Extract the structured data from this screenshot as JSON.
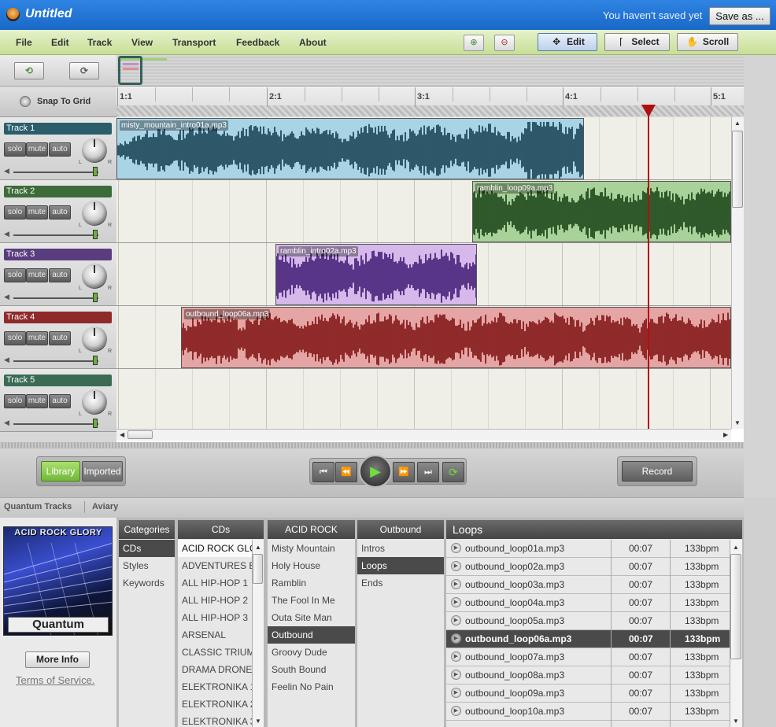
{
  "titlebar": {
    "title": "Untitled",
    "status": "You haven't saved yet",
    "save_as": "Save as ..."
  },
  "menu": {
    "items": [
      "File",
      "Edit",
      "Track",
      "View",
      "Transport",
      "Feedback",
      "About"
    ]
  },
  "modes": {
    "edit": "Edit",
    "select": "Select",
    "scroll": "Scroll"
  },
  "snap_to_grid": "Snap To Grid",
  "ruler": {
    "labels": [
      "1:1",
      "2:1",
      "3:1",
      "4:1",
      "5:1"
    ]
  },
  "tracks": [
    {
      "name": "Track 1",
      "color": "#2b5d6b",
      "clip": "misty_mountain_intro01a.mp3"
    },
    {
      "name": "Track 2",
      "color": "#3e6b3a",
      "clip": "ramblin_loop09a.mp3"
    },
    {
      "name": "Track 3",
      "color": "#5a3d7e",
      "clip": "ramblin_intro02a.mp3"
    },
    {
      "name": "Track 4",
      "color": "#8e2a2a",
      "clip": "outbound_loop06a.mp3"
    },
    {
      "name": "Track 5",
      "color": "#3b6b55",
      "clip": ""
    }
  ],
  "track_buttons": {
    "solo": "solo",
    "mute": "mute",
    "auto": "auto",
    "left": "L",
    "right": "R"
  },
  "transport": {
    "library": "Library",
    "imported": "Imported",
    "record": "Record"
  },
  "providers": [
    "Quantum Tracks",
    "Aviary"
  ],
  "album": {
    "title": "ACID ROCK GLORY",
    "brand": "Quantum",
    "more_info": "More Info",
    "terms": "Terms of Service."
  },
  "categories": {
    "header": "Categories",
    "items": [
      "CDs",
      "Styles",
      "Keywords"
    ],
    "selected": "CDs"
  },
  "cds": {
    "header": "CDs",
    "items": [
      "ACID ROCK GLOR",
      "ADVENTURES BE",
      "ALL HIP-HOP 1",
      "ALL HIP-HOP 2",
      "ALL HIP-HOP 3",
      "ARSENAL",
      "CLASSIC TRIUMP",
      "DRAMA DRONES",
      "ELEKTRONIKA 1",
      "ELEKTRONIKA 2",
      "ELEKTRONIKA 3"
    ],
    "selected": "ACID ROCK GLOR"
  },
  "album_col": {
    "header": "ACID ROCK GLORY",
    "items": [
      "Misty Mountain",
      "Holy House",
      "Ramblin",
      "The Fool In Me",
      "Outa Site Man",
      "Outbound",
      "Groovy Dude",
      "South Bound",
      "Feelin No Pain"
    ],
    "selected": "Outbound"
  },
  "song_col": {
    "header": "Outbound",
    "items": [
      "Intros",
      "Loops",
      "Ends"
    ],
    "selected": "Loops"
  },
  "loops": {
    "header": "Loops",
    "rows": [
      {
        "file": "outbound_loop01a.mp3",
        "time": "00:07",
        "bpm": "133bpm"
      },
      {
        "file": "outbound_loop02a.mp3",
        "time": "00:07",
        "bpm": "133bpm"
      },
      {
        "file": "outbound_loop03a.mp3",
        "time": "00:07",
        "bpm": "133bpm"
      },
      {
        "file": "outbound_loop04a.mp3",
        "time": "00:07",
        "bpm": "133bpm"
      },
      {
        "file": "outbound_loop05a.mp3",
        "time": "00:07",
        "bpm": "133bpm"
      },
      {
        "file": "outbound_loop06a.mp3",
        "time": "00:07",
        "bpm": "133bpm"
      },
      {
        "file": "outbound_loop07a.mp3",
        "time": "00:07",
        "bpm": "133bpm"
      },
      {
        "file": "outbound_loop08a.mp3",
        "time": "00:07",
        "bpm": "133bpm"
      },
      {
        "file": "outbound_loop09a.mp3",
        "time": "00:07",
        "bpm": "133bpm"
      },
      {
        "file": "outbound_loop10a.mp3",
        "time": "00:07",
        "bpm": "133bpm"
      }
    ],
    "selected_index": 5
  },
  "icons": {
    "zoom_in": "zoom-in-icon",
    "zoom_out": "zoom-out-icon",
    "edit": "move-cross-icon",
    "select": "text-cursor-icon",
    "scroll": "hand-icon",
    "undo": "undo-icon",
    "redo": "redo-icon",
    "rewind": "skip-back-icon",
    "back": "rewind-icon",
    "play": "play-icon",
    "forward": "fast-forward-icon",
    "end": "skip-forward-icon",
    "loop": "loop-icon"
  }
}
